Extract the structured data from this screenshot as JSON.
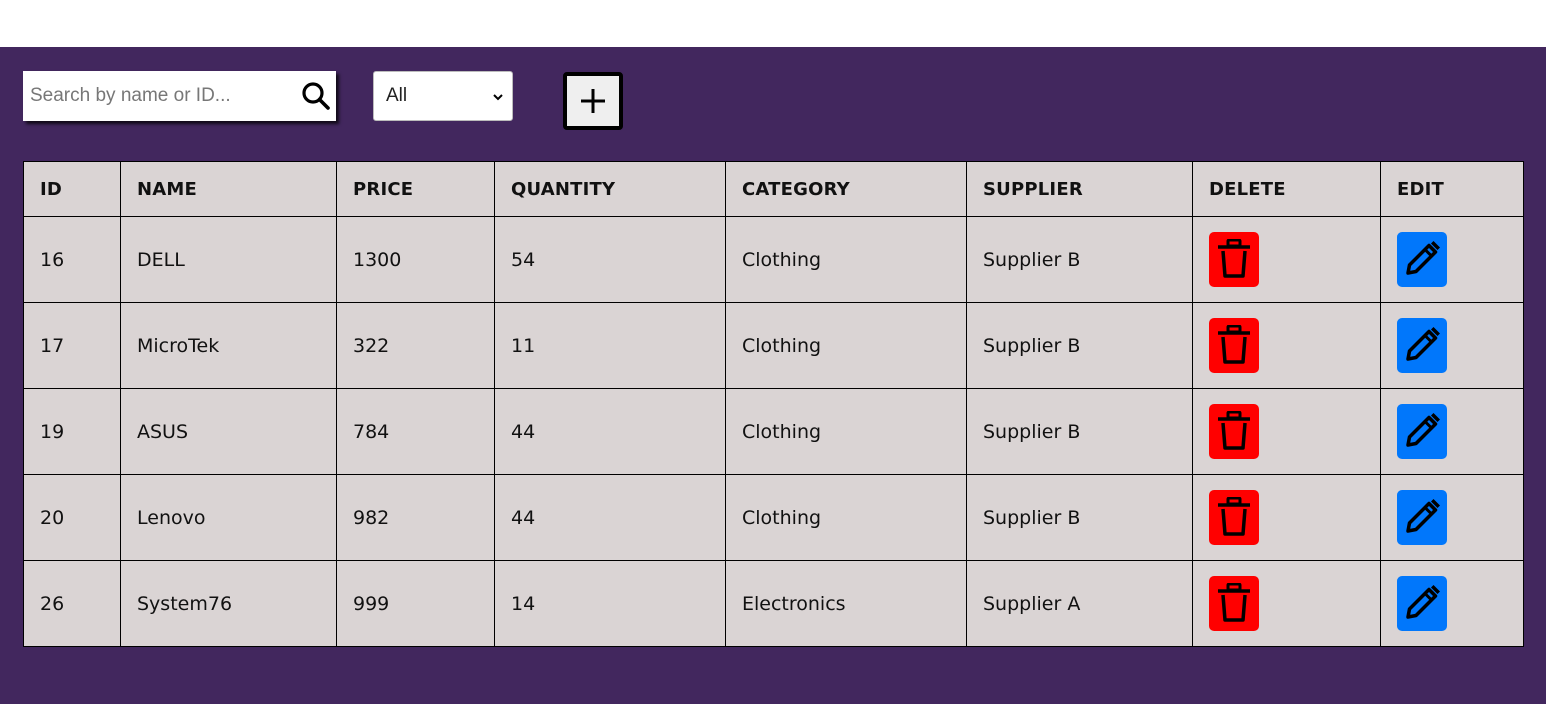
{
  "toolbar": {
    "search_placeholder": "Search by name or ID...",
    "search_value": "",
    "category_selected": "All",
    "icons": {
      "search": "search-icon",
      "chevron": "chevron-down-icon",
      "add": "plus-icon"
    }
  },
  "table": {
    "headers": [
      "ID",
      "NAME",
      "PRICE",
      "QUANTITY",
      "CATEGORY",
      "SUPPLIER",
      "DELETE",
      "EDIT"
    ],
    "rows": [
      {
        "id": "16",
        "name": "DELL",
        "price": "1300",
        "quantity": "54",
        "category": "Clothing",
        "supplier": "Supplier B"
      },
      {
        "id": "17",
        "name": "MicroTek",
        "price": "322",
        "quantity": "11",
        "category": "Clothing",
        "supplier": "Supplier B"
      },
      {
        "id": "19",
        "name": "ASUS",
        "price": "784",
        "quantity": "44",
        "category": "Clothing",
        "supplier": "Supplier B"
      },
      {
        "id": "20",
        "name": "Lenovo",
        "price": "982",
        "quantity": "44",
        "category": "Clothing",
        "supplier": "Supplier B"
      },
      {
        "id": "26",
        "name": "System76",
        "price": "999",
        "quantity": "14",
        "category": "Electronics",
        "supplier": "Supplier A"
      }
    ],
    "row_icons": {
      "delete": "trash-icon",
      "edit": "pencil-icon"
    }
  },
  "colors": {
    "panel_bg": "#42275e",
    "table_bg": "#dad4d4",
    "delete_button": "#ff0000",
    "edit_button": "#0177fb"
  }
}
